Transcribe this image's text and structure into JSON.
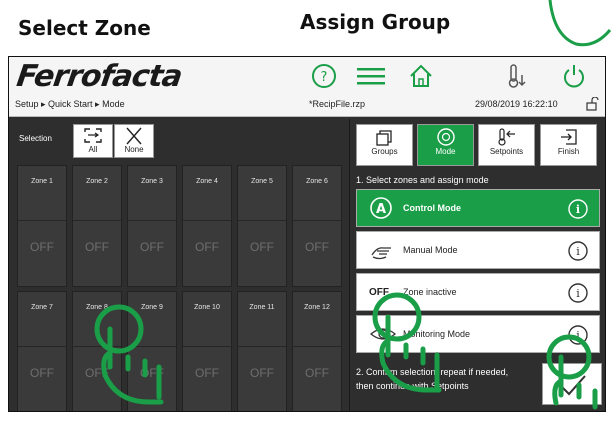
{
  "captions": {
    "left": "Select Zone",
    "right": "Assign Group"
  },
  "header": {
    "logo": "Ferrofacta",
    "breadcrumb": "Setup ▸ Quick Start ▸ Mode",
    "recipe_file": "*RecipFile.rzp",
    "datetime": "29/08/2019 16:22:10"
  },
  "icons": {
    "help": "question-circle",
    "menu": "hamburger",
    "home": "house",
    "temp_down": "thermometer-down",
    "power": "power",
    "lock": "padlock-open"
  },
  "selection": {
    "label": "Selection",
    "all": "All",
    "none": "None"
  },
  "zones": [
    {
      "label": "Zone 1",
      "state": "OFF"
    },
    {
      "label": "Zone 2",
      "state": "OFF"
    },
    {
      "label": "Zone 3",
      "state": "OFF"
    },
    {
      "label": "Zone 4",
      "state": "OFF"
    },
    {
      "label": "Zone 5",
      "state": "OFF"
    },
    {
      "label": "Zone 6",
      "state": "OFF"
    },
    {
      "label": "Zone 7",
      "state": "OFF"
    },
    {
      "label": "Zone 8",
      "state": "OFF"
    },
    {
      "label": "Zone 9",
      "state": "OFF"
    },
    {
      "label": "Zone 10",
      "state": "OFF"
    },
    {
      "label": "Zone 11",
      "state": "OFF"
    },
    {
      "label": "Zone 12",
      "state": "OFF"
    }
  ],
  "tabs": [
    {
      "label": "Groups",
      "icon": "groups-icon",
      "active": false
    },
    {
      "label": "Mode",
      "icon": "mode-icon",
      "active": true
    },
    {
      "label": "Setpoints",
      "icon": "setpoints-icon",
      "active": false
    },
    {
      "label": "Finish",
      "icon": "finish-icon",
      "active": false
    }
  ],
  "step1": "1. Select zones and assign mode",
  "modes": [
    {
      "label": "Control Mode",
      "icon": "control-mode-icon",
      "active": true
    },
    {
      "label": "Manual Mode",
      "icon": "hand-icon",
      "active": false
    },
    {
      "label": "Zone inactive",
      "prefix": "OFF",
      "active": false
    },
    {
      "label": "Monitoring Mode",
      "icon": "eye-icon",
      "active": false
    }
  ],
  "step2": "2. Confirm selection, repeat if needed, then continue with Setpoints",
  "colors": {
    "accent": "#1a9e48",
    "brand_red": "#d71920",
    "panel": "#2e2e2e",
    "zone_tile": "#3a3a3a"
  }
}
